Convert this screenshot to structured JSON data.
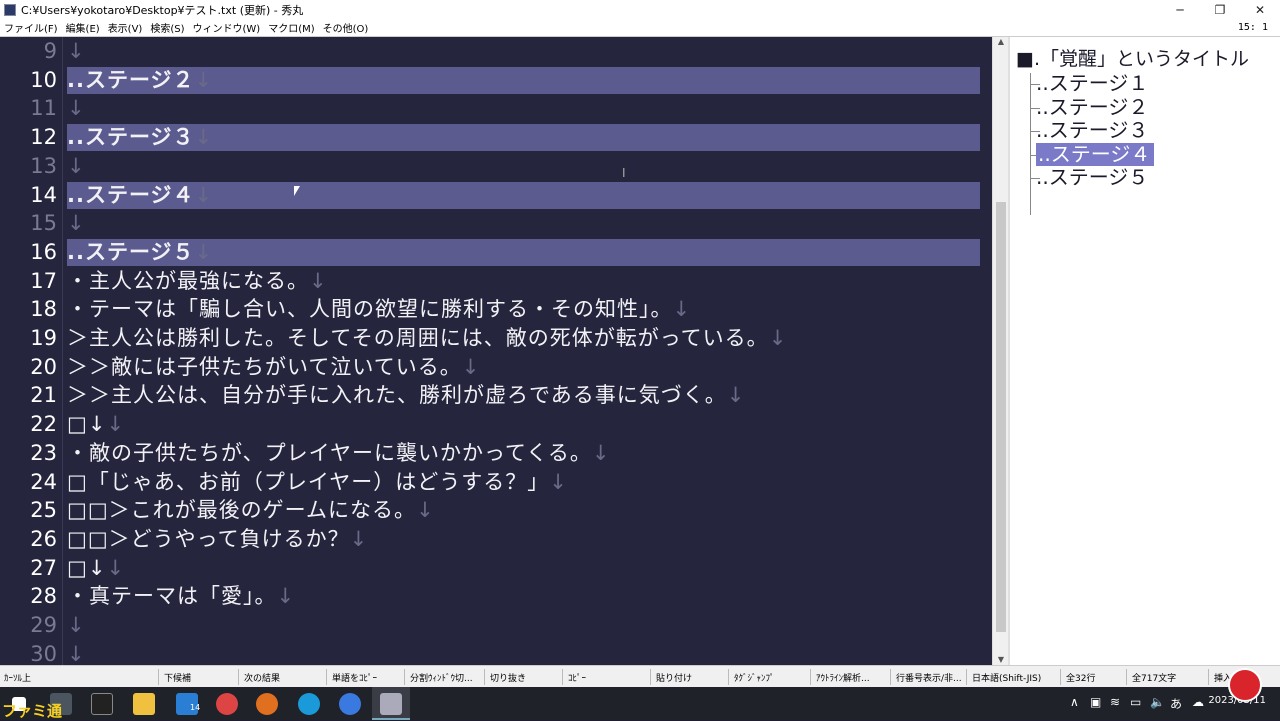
{
  "window": {
    "title": "C:¥Users¥yokotaro¥Desktop¥テスト.txt (更新) - 秀丸",
    "minimize": "─",
    "restore": "❐",
    "close": "✕"
  },
  "menu": {
    "items": [
      "ファイル(F)",
      "編集(E)",
      "表示(V)",
      "検索(S)",
      "ウィンドウ(W)",
      "マクロ(M)",
      "その他(O)"
    ],
    "cursor_pos": "15: 1"
  },
  "editor": {
    "eol_mark": "↓",
    "lines": [
      {
        "num": "9",
        "text": "",
        "heading": false
      },
      {
        "num": "10",
        "text": "..ステージ２",
        "heading": true
      },
      {
        "num": "11",
        "text": "",
        "heading": false
      },
      {
        "num": "12",
        "text": "..ステージ３",
        "heading": true
      },
      {
        "num": "13",
        "text": "",
        "heading": false
      },
      {
        "num": "14",
        "text": "..ステージ４",
        "heading": true
      },
      {
        "num": "15",
        "text": "",
        "heading": false
      },
      {
        "num": "16",
        "text": "..ステージ５",
        "heading": true
      },
      {
        "num": "17",
        "text": "・主人公が最強になる。",
        "heading": false
      },
      {
        "num": "18",
        "text": "・テーマは「騙し合い、人間の欲望に勝利する・その知性」。",
        "heading": false
      },
      {
        "num": "19",
        "text": "＞主人公は勝利した。そしてその周囲には、敵の死体が転がっている。",
        "heading": false
      },
      {
        "num": "20",
        "text": "＞＞敵には子供たちがいて泣いている。",
        "heading": false
      },
      {
        "num": "21",
        "text": "＞＞主人公は、自分が手に入れた、勝利が虚ろである事に気づく。",
        "heading": false
      },
      {
        "num": "22",
        "text": "□↓",
        "heading": false
      },
      {
        "num": "23",
        "text": "・敵の子供たちが、プレイヤーに襲いかかってくる。",
        "heading": false
      },
      {
        "num": "24",
        "text": "□「じゃあ、お前（プレイヤー）はどうする？」",
        "heading": false
      },
      {
        "num": "25",
        "text": "□□＞これが最後のゲームになる。",
        "heading": false
      },
      {
        "num": "26",
        "text": "□□＞どうやって負けるか？",
        "heading": false
      },
      {
        "num": "27",
        "text": "□↓",
        "heading": false
      },
      {
        "num": "28",
        "text": "・真テーマは「愛」。",
        "heading": false
      },
      {
        "num": "29",
        "text": "",
        "heading": false
      },
      {
        "num": "30",
        "text": "",
        "heading": false
      }
    ]
  },
  "outline": {
    "root": ".「覚醒」というタイトル",
    "items": [
      {
        "label": "..ステージ１",
        "selected": false
      },
      {
        "label": "..ステージ２",
        "selected": false
      },
      {
        "label": "..ステージ３",
        "selected": false
      },
      {
        "label": "..ステージ４",
        "selected": true
      },
      {
        "label": "..ステージ５",
        "selected": false
      }
    ]
  },
  "funcbar": [
    "ｶｰｿﾙ上",
    "下候補",
    "次の結果",
    "単語をｺﾋﾟｰ",
    "分割ｳｨﾝﾄﾞｳ切...",
    "切り抜き",
    "ｺﾋﾟｰ",
    "貼り付け",
    "ﾀｸﾞｼﾞｬﾝﾌﾟ",
    "ｱｳﾄﾗｲﾝ解析...",
    "行番号表示/非...",
    "日本語(Shift-JIS)",
    "全32行",
    "全717文字",
    "挿入"
  ],
  "taskbar": {
    "date": "2023/03/11",
    "ime": "あ",
    "edge_badge": "14"
  },
  "watermark": "ファミ通",
  "colors": {
    "editor_bg": "#25253d",
    "heading_bg": "#5b5b8f",
    "outline_selected": "#7a7ac8"
  }
}
